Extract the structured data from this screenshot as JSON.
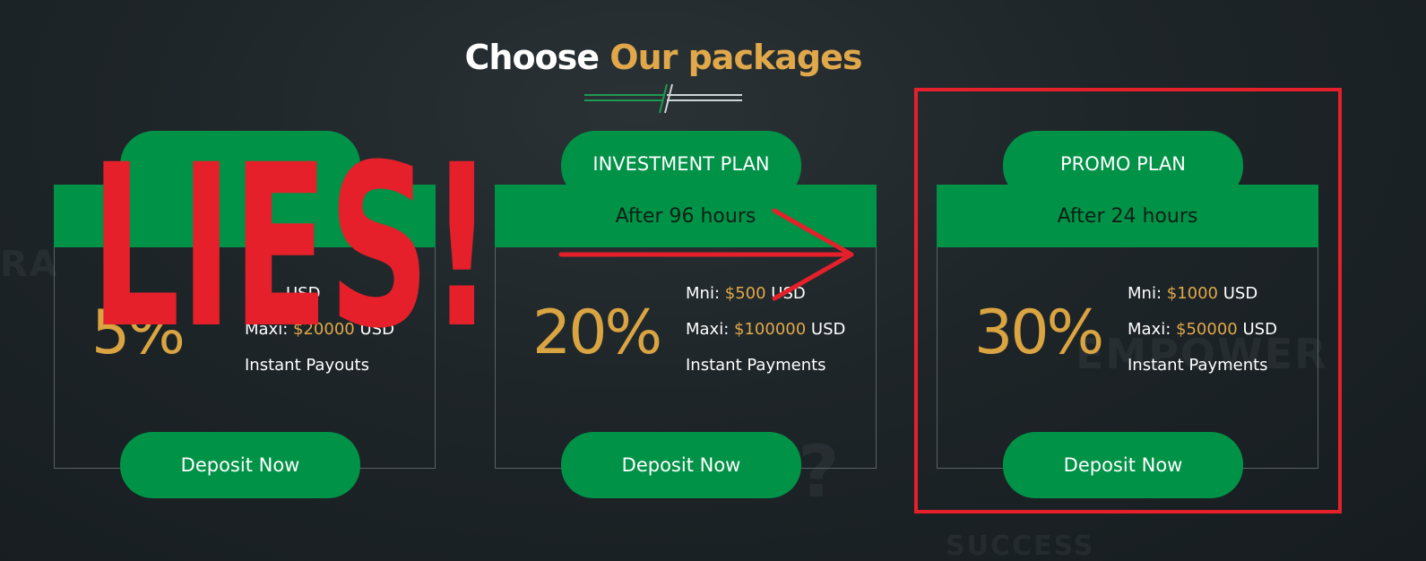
{
  "section": {
    "title_white": "Choose",
    "title_orange": "Our packages"
  },
  "plans": [
    {
      "name": "",
      "after": "",
      "percent": "5%",
      "min_label": "",
      "min_value": "",
      "min_unit": "USD",
      "max_label": "Maxi:",
      "max_value": "$20000",
      "max_unit": "USD",
      "payout": "Instant Payouts",
      "button": "Deposit Now"
    },
    {
      "name": "INVESTMENT PLAN",
      "after": "After 96 hours",
      "percent": "20%",
      "min_label": "Mni:",
      "min_value": "$500",
      "min_unit": "USD",
      "max_label": "Maxi:",
      "max_value": "$100000",
      "max_unit": "USD",
      "payout": "Instant Payments",
      "button": "Deposit Now"
    },
    {
      "name": "PROMO PLAN",
      "after": "After 24 hours",
      "percent": "30%",
      "min_label": "Mni:",
      "min_value": "$1000",
      "min_unit": "USD",
      "max_label": "Maxi:",
      "max_value": "$50000",
      "max_unit": "USD",
      "payout": "Instant Payments",
      "button": "Deposit Now"
    }
  ],
  "overlay": {
    "stamp_text": "LIES!",
    "color": "#e5202a"
  },
  "colors": {
    "green": "#009246",
    "gold": "#d9a441",
    "background": "#1e2528"
  }
}
